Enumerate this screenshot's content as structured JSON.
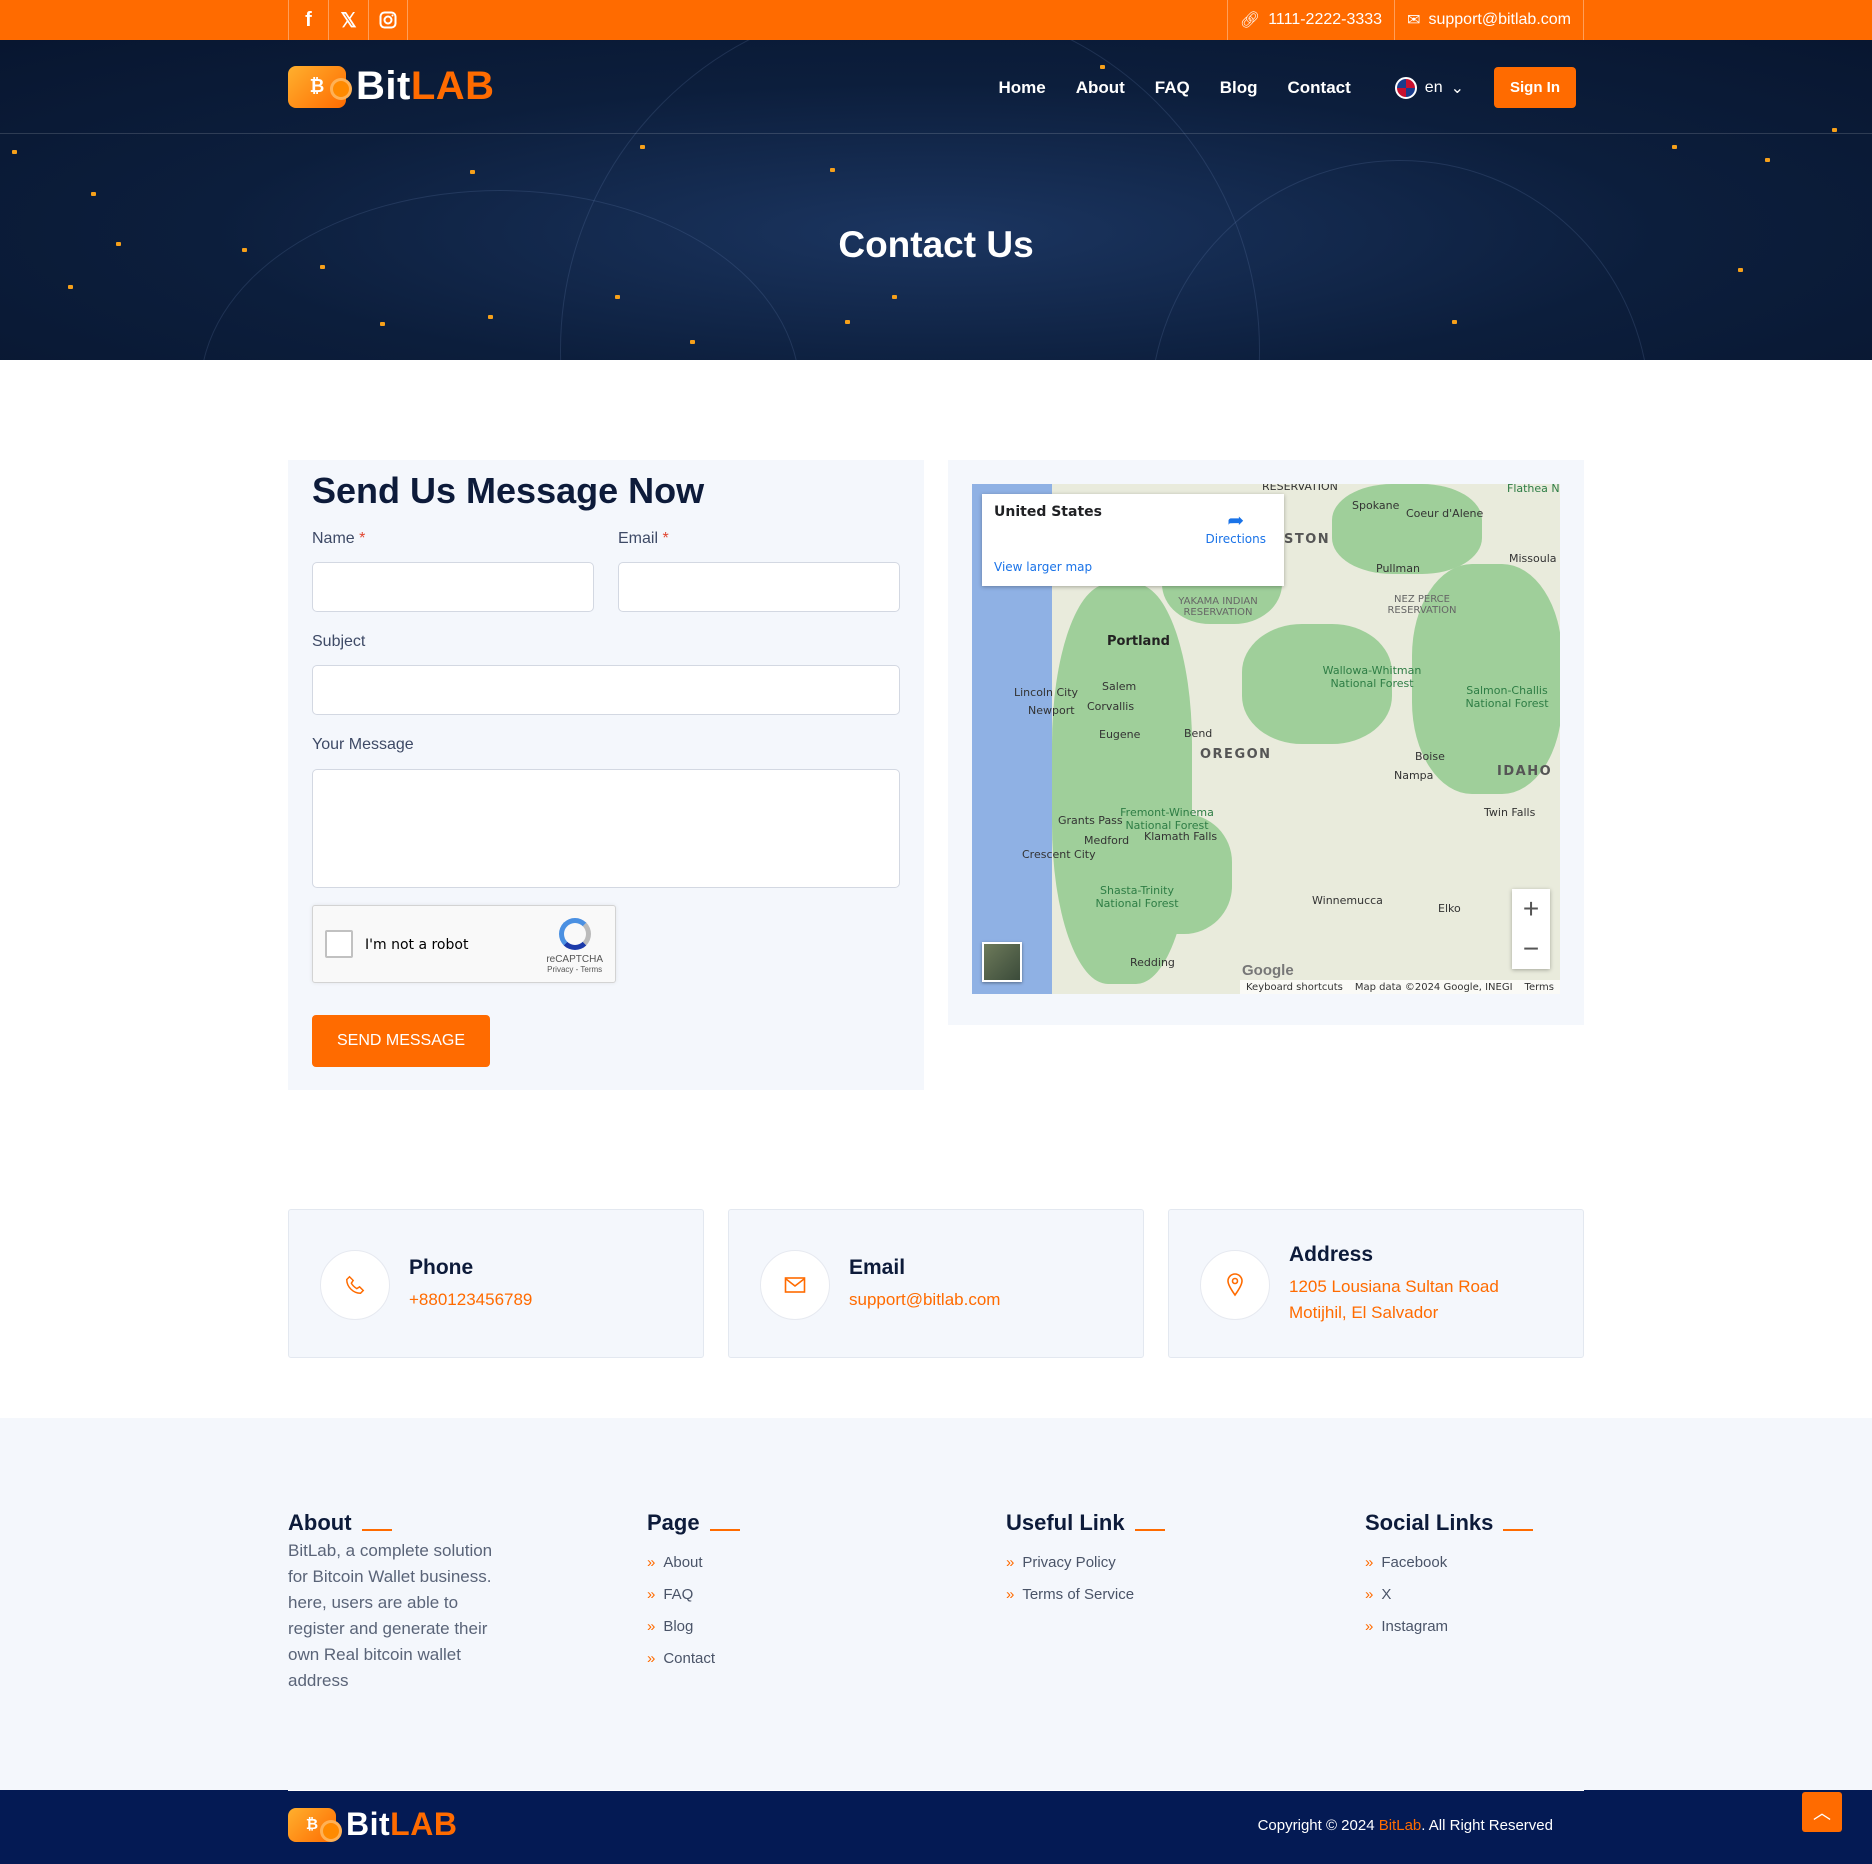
{
  "topbar": {
    "social_icons": [
      "facebook-icon",
      "x-icon",
      "instagram-icon"
    ],
    "phone": "1111-2222-3333",
    "email": "support@bitlab.com"
  },
  "brand": {
    "name_part1": "Bit",
    "name_part2": "LAB",
    "accent": "#ff6b00",
    "navy": "#0c1e3c"
  },
  "nav": {
    "items": [
      "Home",
      "About",
      "FAQ",
      "Blog",
      "Contact"
    ],
    "lang": "en",
    "signin": "Sign In"
  },
  "hero": {
    "title": "Contact Us"
  },
  "form": {
    "heading": "Send Us Message Now",
    "name_label": "Name",
    "email_label": "Email",
    "required_mark": "*",
    "subject_label": "Subject",
    "message_label": "Your Message",
    "captcha_text": "I'm not a robot",
    "captcha_brand": "reCAPTCHA",
    "captcha_links": "Privacy - Terms",
    "submit": "SEND MESSAGE"
  },
  "map": {
    "place": "United States",
    "directions": "Directions",
    "larger": "View larger map",
    "google": "Google",
    "attr_shortcuts": "Keyboard shortcuts",
    "attr_data": "Map data ©2024 Google, INEGI",
    "attr_terms": "Terms",
    "labels": {
      "portland": "Portland",
      "salem": "Salem",
      "corvallis": "Corvallis",
      "eugene": "Eugene",
      "bend": "Bend",
      "oregon": "OREGON",
      "idaho": "IDAHO",
      "spokane": "Spokane",
      "coeur": "Coeur d'Alene",
      "pullman": "Pullman",
      "missoula": "Missoula",
      "lincoln": "Lincoln City",
      "newport": "Newport",
      "grants": "Grants Pass",
      "medford": "Medford",
      "klamath": "Klamath Falls",
      "crescent": "Crescent City",
      "redding": "Redding",
      "boise": "Boise",
      "nampa": "Nampa",
      "twin": "Twin Falls",
      "winnemucca": "Winnemucca",
      "elko": "Elko",
      "yakama": "YAKAMA INDIAN RESERVATION",
      "nez": "NEZ PERCE RESERVATION",
      "ston": "STON",
      "reservation_top": "RESERVATION",
      "wallowa": "Wallowa-Whitman National Forest",
      "salmon": "Salmon-Challis National Forest",
      "fremont": "Fremont-Winema National Forest",
      "shasta": "Shasta-Trinity National Forest",
      "flathead": "Flathea National Fo"
    }
  },
  "info": {
    "phone": {
      "title": "Phone",
      "value": "+880123456789"
    },
    "email": {
      "title": "Email",
      "value": "support@bitlab.com"
    },
    "address": {
      "title": "Address",
      "line1": "1205 Lousiana Sultan Road",
      "line2": "Motijhil, El Salvador"
    }
  },
  "footer": {
    "about_title": "About",
    "about_text": "BitLab, a complete solution for Bitcoin Wallet business. here, users are able to register and generate their own Real bitcoin wallet address",
    "page_title": "Page",
    "pages": [
      "About",
      "FAQ",
      "Blog",
      "Contact"
    ],
    "useful_title": "Useful Link",
    "useful": [
      "Privacy Policy",
      "Terms of Service"
    ],
    "social_title": "Social Links",
    "social": [
      "Facebook",
      "X",
      "Instagram"
    ],
    "copy_pre": "Copyright © 2024 ",
    "copy_brand": "BitLab",
    "copy_post": ". All Right Reserved"
  }
}
